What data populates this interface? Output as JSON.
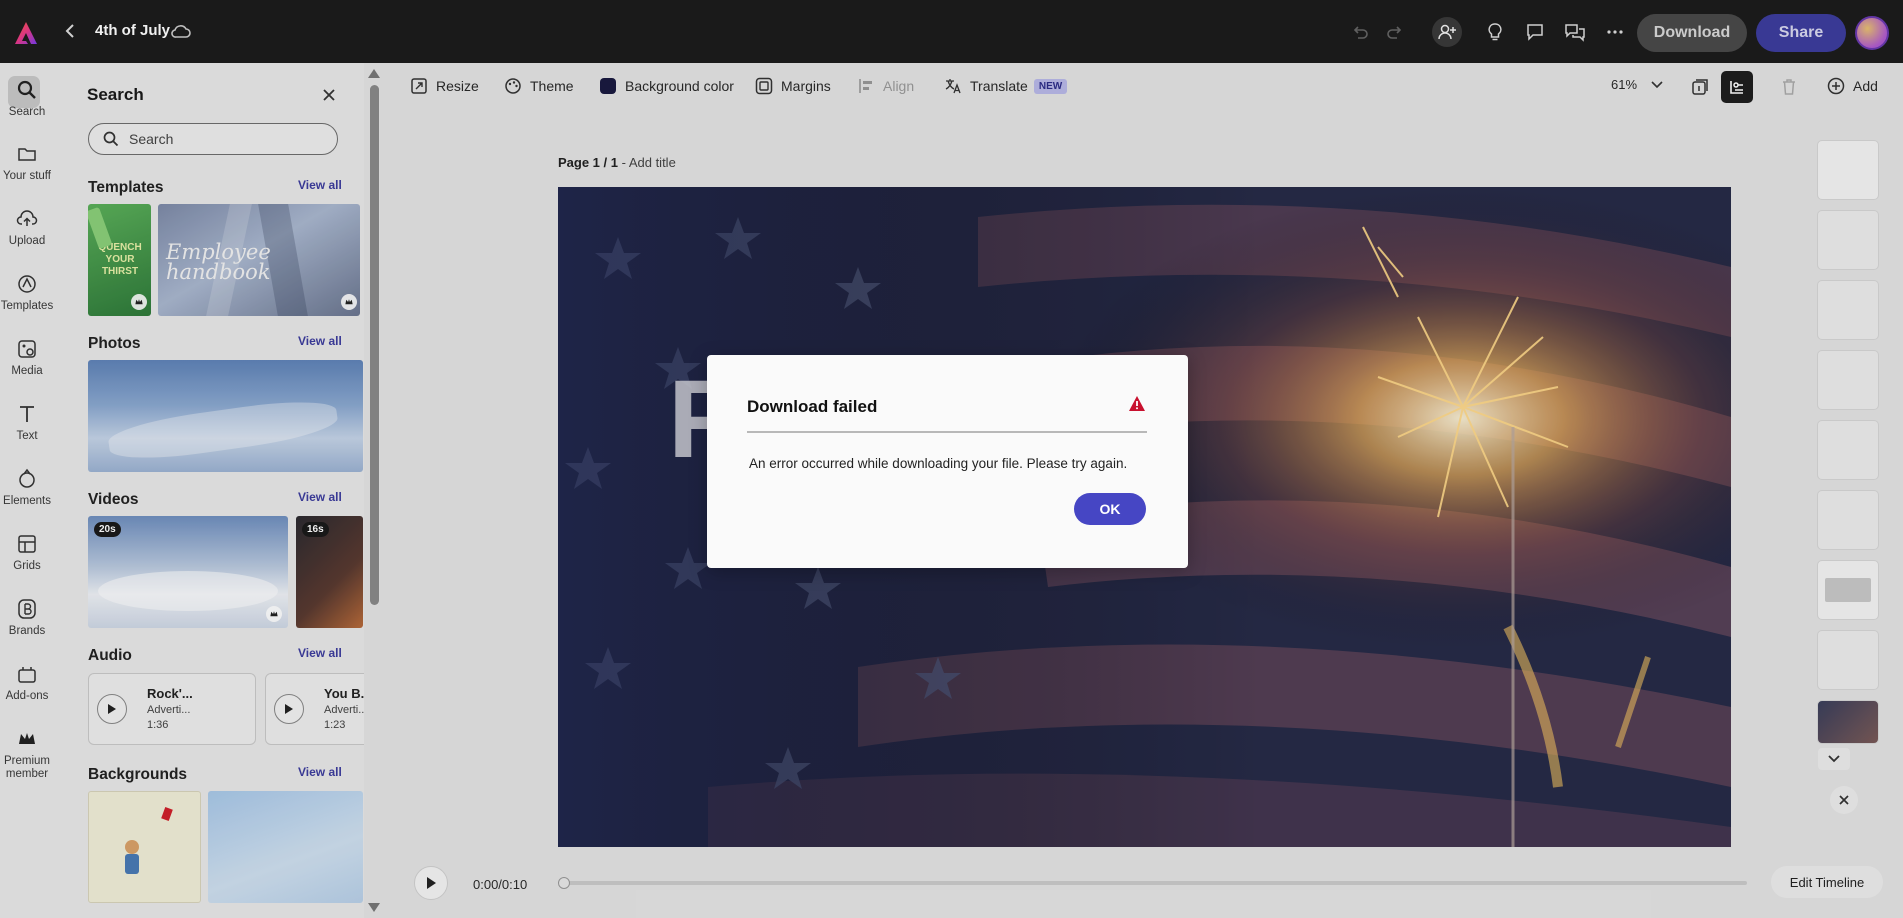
{
  "topbar": {
    "title": "4th of July",
    "download_label": "Download",
    "share_label": "Share"
  },
  "rail": {
    "items": [
      {
        "label": "Search",
        "icon": "search-icon"
      },
      {
        "label": "Your stuff",
        "icon": "folder-icon"
      },
      {
        "label": "Upload",
        "icon": "upload-icon"
      },
      {
        "label": "Templates",
        "icon": "templates-icon"
      },
      {
        "label": "Media",
        "icon": "media-icon"
      },
      {
        "label": "Text",
        "icon": "text-icon"
      },
      {
        "label": "Elements",
        "icon": "elements-icon"
      },
      {
        "label": "Grids",
        "icon": "grids-icon"
      },
      {
        "label": "Brands",
        "icon": "brands-icon"
      },
      {
        "label": "Add-ons",
        "icon": "addons-icon"
      },
      {
        "label": "Premium member",
        "icon": "crown-icon"
      }
    ]
  },
  "panel": {
    "title": "Search",
    "search_placeholder": "Search",
    "view_all": "View all",
    "templates_title": "Templates",
    "template1_text": "QUENCH YOUR THIRST",
    "template2_text": "Employee handbook",
    "photos_title": "Photos",
    "videos_title": "Videos",
    "video1_duration": "20s",
    "video2_duration": "16s",
    "audio_title": "Audio",
    "audio": [
      {
        "name": "Rock'...",
        "sub": "Adverti...",
        "duration": "1:36"
      },
      {
        "name": "You B...",
        "sub": "Adverti...",
        "duration": "1:23"
      }
    ],
    "backgrounds_title": "Backgrounds"
  },
  "toolbar": {
    "resize": "Resize",
    "theme": "Theme",
    "background_color": "Background color",
    "margins": "Margins",
    "align": "Align",
    "translate": "Translate",
    "new_badge": "NEW",
    "zoom": "61%",
    "add": "Add"
  },
  "canvas": {
    "page_number": "Page 1 / 1",
    "page_sep": " - ",
    "add_title": "Add title",
    "artboard_letter": "F"
  },
  "timeline": {
    "time": "0:00/0:10",
    "progress": 0,
    "edit_label": "Edit Timeline"
  },
  "modal": {
    "title": "Download failed",
    "message": "An error occurred while downloading your file. Please try again.",
    "ok_label": "OK"
  },
  "colors": {
    "accent": "#4646c4",
    "topbar": "#1c1c1c",
    "warning": "#c8102e"
  }
}
